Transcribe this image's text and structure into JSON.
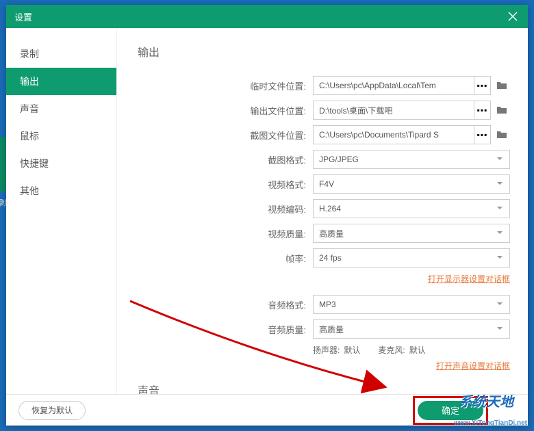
{
  "title": "设置",
  "sidebar": {
    "items": [
      {
        "label": "录制"
      },
      {
        "label": "输出"
      },
      {
        "label": "声音"
      },
      {
        "label": "鼠标"
      },
      {
        "label": "快捷键"
      },
      {
        "label": "其他"
      }
    ],
    "activeIndex": 1
  },
  "sections": {
    "output_title": "输出",
    "sound_title": "声音"
  },
  "rows": {
    "temp_label": "临时文件位置:",
    "temp_value": "C:\\Users\\pc\\AppData\\Local\\Tem",
    "out_label": "输出文件位置:",
    "out_value": "D:\\tools\\桌面\\下载吧",
    "shot_label": "截图文件位置:",
    "shot_value": "C:\\Users\\pc\\Documents\\Tipard S",
    "shot_fmt_label": "截图格式:",
    "shot_fmt_value": "JPG/JPEG",
    "vid_fmt_label": "视频格式:",
    "vid_fmt_value": "F4V",
    "vid_enc_label": "视频编码:",
    "vid_enc_value": "H.264",
    "vid_q_label": "视频质量:",
    "vid_q_value": "高质量",
    "fps_label": "帧率:",
    "fps_value": "24 fps",
    "aud_fmt_label": "音频格式:",
    "aud_fmt_value": "MP3",
    "aud_q_label": "音频质量:",
    "aud_q_value": "高质量",
    "speaker_label": "扬声器:",
    "speaker_value": "默认",
    "mic_label": "麦克风:",
    "mic_value": "默认"
  },
  "links": {
    "display": "打开显示器设置对话框",
    "sound": "打开声音设置对话框"
  },
  "buttons": {
    "restore": "恢复为默认",
    "ok": "确定",
    "dots": "▪▪▪"
  },
  "watermark": {
    "line1": "系统天地",
    "line2": "www.XiTongTianDi.net"
  }
}
